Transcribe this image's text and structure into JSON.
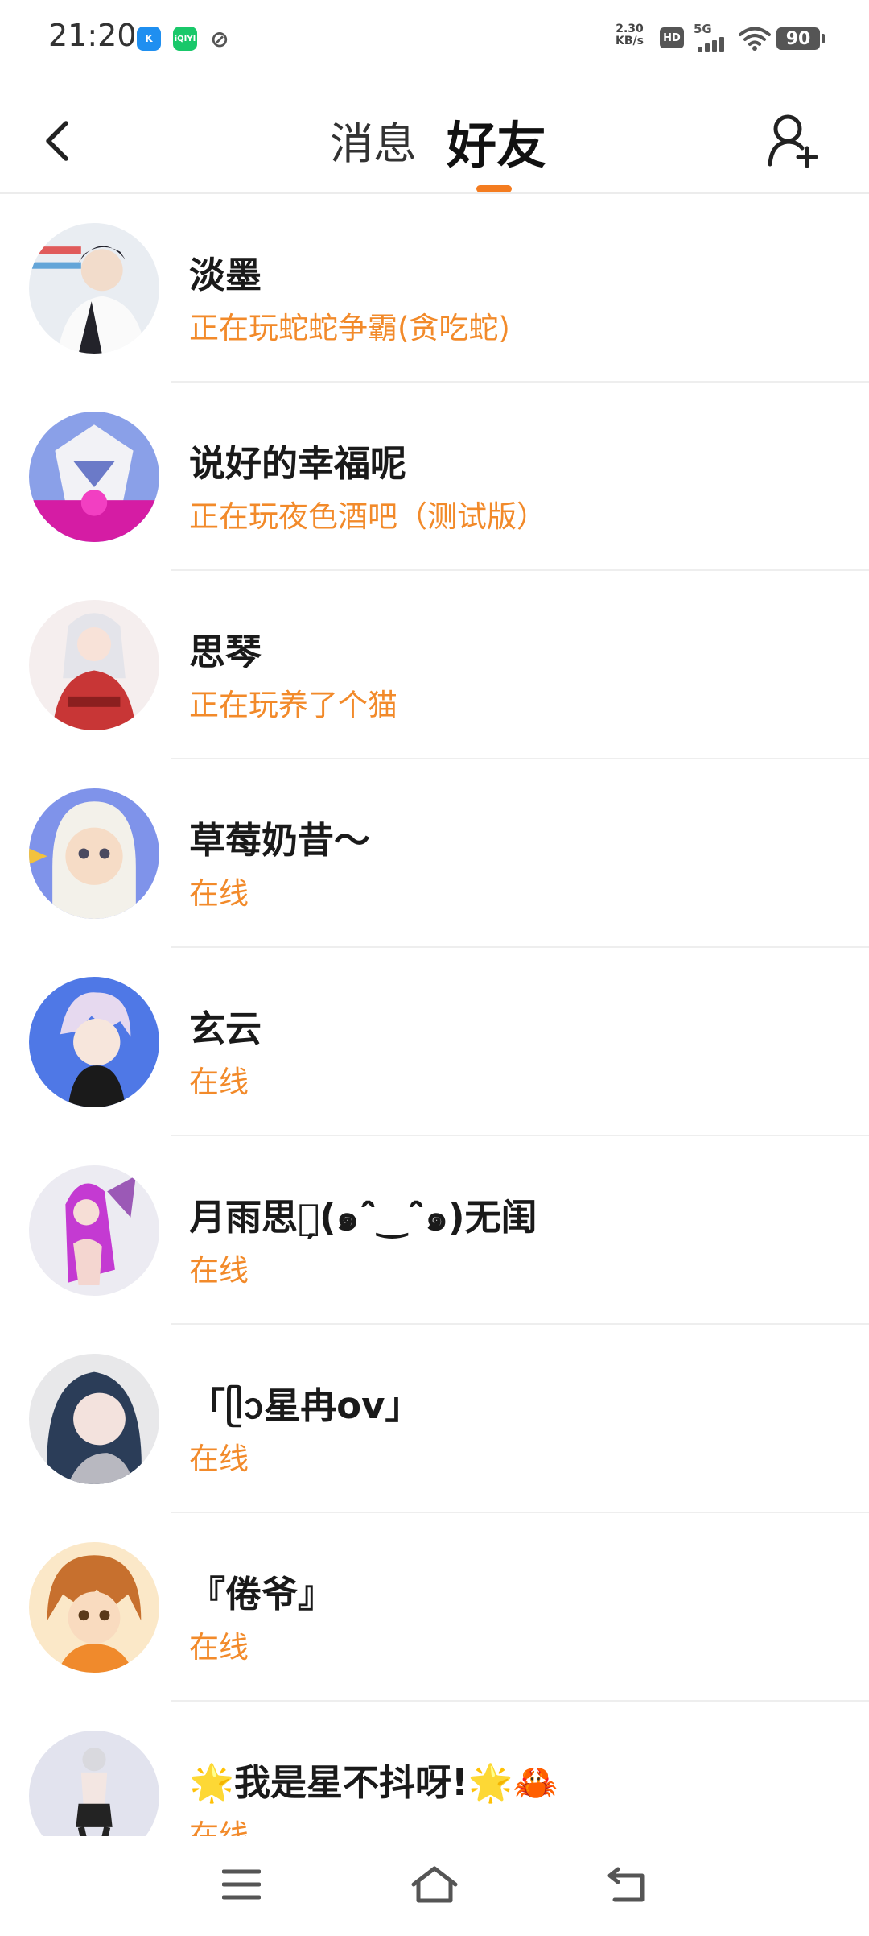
{
  "status_bar": {
    "time": "21:20",
    "apps": [
      "K",
      "iQIYI"
    ],
    "net_speed_value": "2.30",
    "net_speed_unit": "KB/s",
    "hd": "HD",
    "signal": "5G",
    "battery": "90"
  },
  "header": {
    "tabs": [
      {
        "label": "消息",
        "active": false
      },
      {
        "label": "好友",
        "active": true
      }
    ],
    "accent_color": "#f47c20"
  },
  "friends": [
    {
      "name": "淡墨",
      "status": "正在玩蛇蛇争霸(贪吃蛇)"
    },
    {
      "name": "说好的幸福呢",
      "status": "正在玩夜色酒吧（测试版）"
    },
    {
      "name": "思琴",
      "status": "正在玩养了个猫"
    },
    {
      "name": "草莓奶昔～",
      "status": "在线"
    },
    {
      "name": "玄云",
      "status": "在线"
    },
    {
      "name": "月雨思醉̦(๑ˆ̑‿ˆ̑๑)无闺",
      "status": "在线"
    },
    {
      "name": "「ᥫᩣ星冉ov」",
      "status": "在线"
    },
    {
      "name": "『倦爷』",
      "status": "在线"
    },
    {
      "name": "🌟我是星不抖呀!🌟🦀",
      "status": "在线"
    }
  ]
}
